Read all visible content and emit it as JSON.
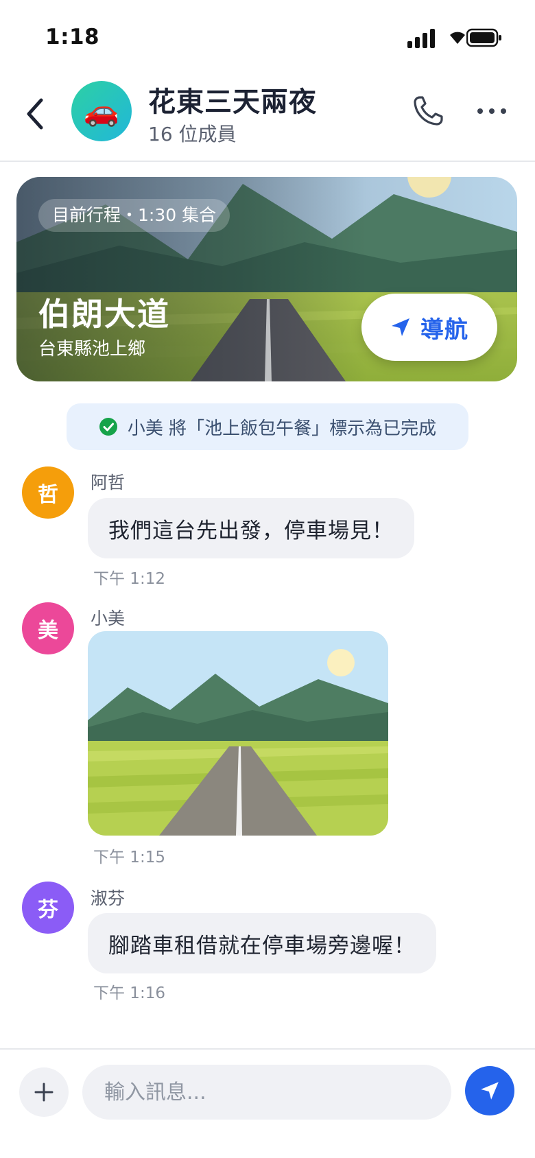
{
  "status_bar": {
    "time": "1:18"
  },
  "header": {
    "group_avatar_emoji": "🚗",
    "group_name": "花東三天兩夜",
    "member_count": "16 位成員",
    "icons": [
      "back-arrow-icon",
      "phone-icon",
      "more-dots-icon"
    ]
  },
  "trip_card": {
    "badge": "目前行程・1:30 集合",
    "place": "伯朗大道",
    "address": "台東縣池上鄉",
    "navigate_label": "導航"
  },
  "system_notice": {
    "text": "小美 將「池上飯包午餐」標示為已完成"
  },
  "messages": [
    {
      "avatar": "哲",
      "avatar_color": "#f59e0b",
      "sender": "阿哲",
      "text": "我們這台先出發，停車場見！",
      "time": "下午 1:12"
    },
    {
      "avatar": "美",
      "avatar_color": "#ec4899",
      "sender": "小美",
      "type": "photo",
      "time": "下午 1:15"
    },
    {
      "avatar": "芬",
      "avatar_color": "#8b5cf6",
      "sender": "淑芬",
      "text": "腳踏車租借就在停車場旁邊喔！",
      "time": "下午 1:16"
    }
  ],
  "input": {
    "placeholder": "輸入訊息..."
  },
  "colors": {
    "accent": "#2563eb",
    "notice_bg": "#e8f1fd",
    "bubble_bg": "#f0f1f5",
    "check": "#16a34a"
  }
}
